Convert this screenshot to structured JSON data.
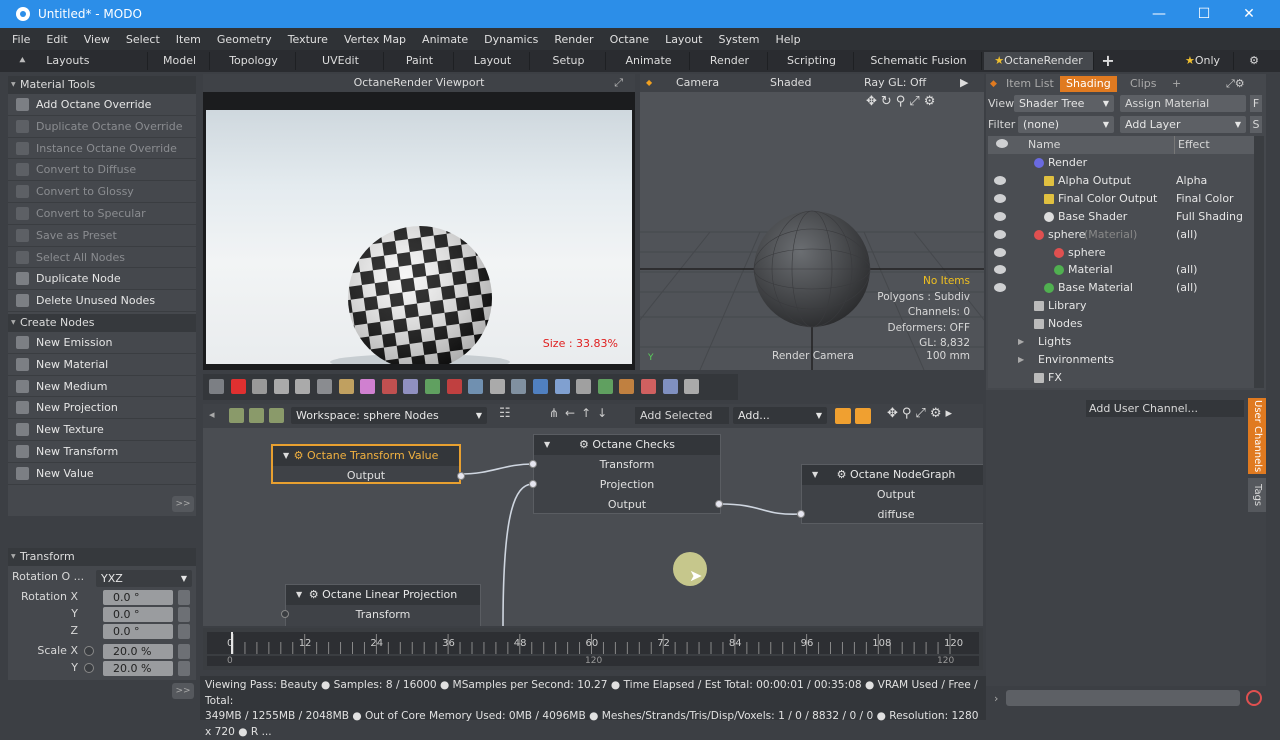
{
  "window": {
    "title": "Untitled* - MODO",
    "minimize": "—",
    "maximize": "☐",
    "close": "✕"
  },
  "menu": [
    "File",
    "Edit",
    "View",
    "Select",
    "Item",
    "Geometry",
    "Texture",
    "Vertex Map",
    "Animate",
    "Dynamics",
    "Render",
    "Octane",
    "Layout",
    "System",
    "Help"
  ],
  "layout_tabs": {
    "layouts": "Layouts",
    "tabs": [
      "Model",
      "Topology",
      "UVEdit",
      "Paint",
      "Layout",
      "Setup",
      "Animate",
      "Render",
      "Scripting",
      "Schematic Fusion",
      "OctaneRender"
    ],
    "only": "Only",
    "plus": "+"
  },
  "material_tools": {
    "header": "Material Tools",
    "items": [
      {
        "label": "Add Octane Override",
        "disabled": false
      },
      {
        "label": "Duplicate Octane Override",
        "disabled": true
      },
      {
        "label": "Instance Octane Override",
        "disabled": true
      },
      {
        "label": "Convert to Diffuse",
        "disabled": true
      },
      {
        "label": "Convert to Glossy",
        "disabled": true
      },
      {
        "label": "Convert to Specular",
        "disabled": true
      },
      {
        "label": "Save as Preset",
        "disabled": true
      },
      {
        "label": "Select All Nodes",
        "disabled": true
      },
      {
        "label": "Duplicate Node",
        "disabled": false
      },
      {
        "label": "Delete Unused Nodes",
        "disabled": false
      }
    ]
  },
  "create_nodes": {
    "header": "Create Nodes",
    "items": [
      "New Emission",
      "New Material",
      "New Medium",
      "New Projection",
      "New Texture",
      "New Transform",
      "New Value"
    ],
    "more": ">>"
  },
  "transform": {
    "header": "Transform",
    "rotation_order_label": "Rotation O ...",
    "rotation_order": "YXZ",
    "rows": [
      {
        "label": "Rotation X",
        "value": "0.0 °"
      },
      {
        "label": "Y",
        "value": "0.0 °"
      },
      {
        "label": "Z",
        "value": "0.0 °"
      },
      {
        "label": "Scale X",
        "value": "20.0 %"
      },
      {
        "label": "Y",
        "value": "20.0 %"
      }
    ],
    "more": ">>"
  },
  "octane_viewport": {
    "title": "OctaneRender Viewport",
    "size_label": "Size : 33.83%"
  },
  "gl_viewport": {
    "camera": "Camera",
    "shaded": "Shaded",
    "raygl": "Ray GL: Off",
    "info": [
      "No Items",
      "Polygons : Subdiv",
      "Channels: 0",
      "Deformers: OFF",
      "GL: 8,832"
    ],
    "render_camera": "Render Camera",
    "distance": "100 mm"
  },
  "node_toolbar": {
    "workspace": "Workspace: sphere Nodes",
    "add_selected": "Add Selected",
    "add": "Add..."
  },
  "nodes": {
    "transform_value": {
      "title": "Octane Transform Value",
      "rows": [
        "Output"
      ]
    },
    "checks": {
      "title": "Octane Checks",
      "rows": [
        "Transform",
        "Projection",
        "Output"
      ]
    },
    "nodegraph": {
      "title": "Octane NodeGraph",
      "rows": [
        "Output",
        "diffuse"
      ]
    },
    "linear_projection": {
      "title": "Octane Linear Projection",
      "rows": [
        "Transform"
      ]
    }
  },
  "timeline": {
    "ticks": [
      "0",
      "12",
      "24",
      "36",
      "48",
      "60",
      "72",
      "84",
      "96",
      "108",
      "120"
    ],
    "start": "0",
    "mid": "120",
    "end": "120",
    "progress": 0
  },
  "status": {
    "line1": "Viewing Pass: Beauty ● Samples: 8  / 16000 ● MSamples per Second: 10.27 ● Time Elapsed / Est Total: 00:00:01 / 00:35:08 ● VRAM Used / Free / Total:",
    "line2": "349MB / 1255MB / 2048MB ● Out of Core Memory Used: 0MB / 4096MB ● Meshes/Strands/Tris/Disp/Voxels: 1 / 0 / 8832 / 0 / 0 ● Resolution: 1280 x 720 ● R ..."
  },
  "shading_panel": {
    "tabs": [
      "Item List",
      "Shading",
      "Clips",
      "+"
    ],
    "view_label": "View",
    "view_value": "Shader Tree",
    "assign_material": "Assign Material",
    "filter_label": "Filter",
    "filter_value": "(none)",
    "add_layer": "Add Layer",
    "col_name": "Name",
    "col_effect": "Effect",
    "rows": [
      {
        "name": "Render",
        "effect": "",
        "indent": 0,
        "eye": false
      },
      {
        "name": "Alpha Output",
        "effect": "Alpha",
        "indent": 2,
        "eye": true
      },
      {
        "name": "Final Color Output",
        "effect": "Final Color",
        "indent": 2,
        "eye": true
      },
      {
        "name": "Base Shader",
        "effect": "Full Shading",
        "indent": 2,
        "eye": true
      },
      {
        "name": "sphere",
        "suffix": "(Material)",
        "effect": "(all)",
        "indent": 1,
        "eye": true
      },
      {
        "name": "sphere",
        "effect": "",
        "indent": 3,
        "eye": true
      },
      {
        "name": "Material",
        "effect": "(all)",
        "indent": 3,
        "eye": true
      },
      {
        "name": "Base Material",
        "effect": "(all)",
        "indent": 2,
        "eye": true
      },
      {
        "name": "Library",
        "effect": "",
        "indent": 1,
        "eye": false
      },
      {
        "name": "Nodes",
        "effect": "",
        "indent": 1,
        "eye": false
      },
      {
        "name": "Lights",
        "effect": "",
        "indent": 0,
        "eye": false
      },
      {
        "name": "Environments",
        "effect": "",
        "indent": 0,
        "eye": false
      },
      {
        "name": "FX",
        "effect": "",
        "indent": 1,
        "eye": false
      }
    ],
    "add_user_channel": "Add User Channel...",
    "side_tabs": [
      "User Channels",
      "Tags"
    ]
  },
  "colors": {
    "accent": "#2c8ee8",
    "selected_node": "#e8a030",
    "shading_tab": "#e07a20"
  }
}
